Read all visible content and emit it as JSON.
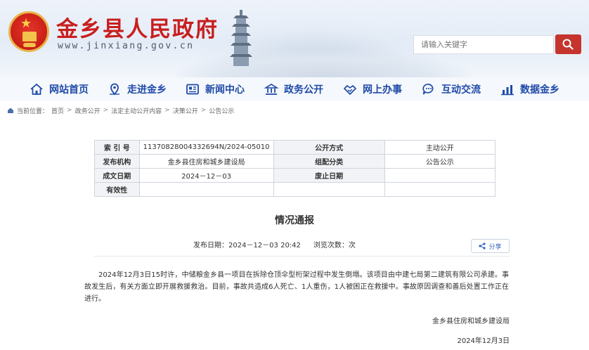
{
  "header": {
    "site_title": "金乡县人民政府",
    "site_url": "www.jinxiang.gov.cn",
    "search_placeholder": "请输入关键字"
  },
  "nav": {
    "items": [
      {
        "label": "网站首页",
        "icon": "home-icon"
      },
      {
        "label": "走进金乡",
        "icon": "location-icon"
      },
      {
        "label": "新闻中心",
        "icon": "newspaper-icon"
      },
      {
        "label": "政务公开",
        "icon": "government-building-icon"
      },
      {
        "label": "网上办事",
        "icon": "handshake-icon"
      },
      {
        "label": "互动交流",
        "icon": "chat-icon"
      },
      {
        "label": "数据金乡",
        "icon": "bar-chart-icon"
      }
    ]
  },
  "breadcrumb": {
    "prefix": "当前位置：",
    "items": [
      "首页",
      "政务公开",
      "法定主动公开内容",
      "决策公开",
      "公告公示"
    ],
    "separator": ">"
  },
  "info_table": {
    "index_label": "索 引 号",
    "index_value": "11370828004332694N/2024-05010",
    "disclosure_label": "公开方式",
    "disclosure_value": "主动公开",
    "publisher_label": "发布机构",
    "publisher_value": "金乡县住房和城乡建设局",
    "category_label": "组配分类",
    "category_value": "公告公示",
    "created_label": "成文日期",
    "created_value": "2024－12－03",
    "expiry_label": "废止日期",
    "expiry_value": "",
    "validity_label": "有效性",
    "validity_value": ""
  },
  "article": {
    "title": "情况通报",
    "published_label": "发布日期：",
    "published_value": "2024－12－03 20:42",
    "views_label": "浏览次数：",
    "views_suffix": "次",
    "share_label": "分享",
    "body": "2024年12月3日15时许，中储粮金乡县一项目在拆除仓顶伞型桁架过程中发生倒塌。该项目由中建七局第二建筑有限公司承建。事故发生后，有关方面立即开展救援救治。目前，事故共造成6人死亡、1人重伤，1人被困正在救援中。事故原因调查和善后处置工作正在进行。",
    "signature": "金乡县住房和城乡建设局",
    "date": "2024年12月3日"
  },
  "colors": {
    "brand_red": "#c91e1e",
    "nav_blue": "#1f4aa8",
    "search_button": "#c5352d"
  }
}
